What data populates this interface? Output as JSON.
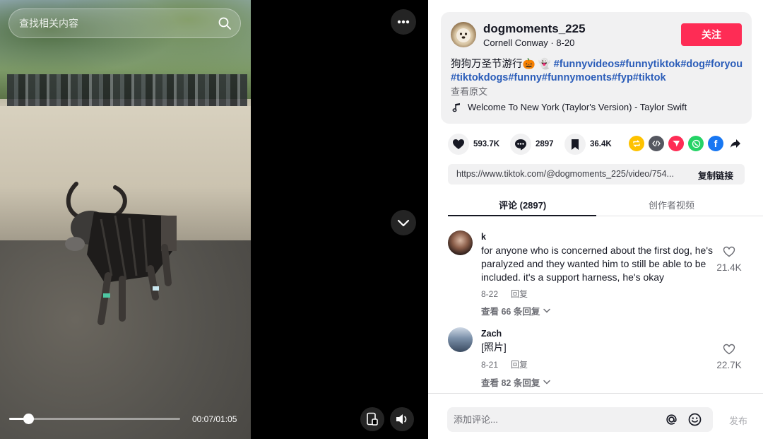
{
  "search": {
    "placeholder": "查找相关内容"
  },
  "player": {
    "time": "00:07/01:05",
    "progress_fraction": 0.11
  },
  "author": {
    "username": "dogmoments_225",
    "display_name": "Cornell Conway",
    "date": "8-20",
    "sub_line": "Cornell Conway · 8-20",
    "follow_label": "关注"
  },
  "caption": {
    "text": "狗狗万圣节游行🎃 👻 ",
    "tags_line1": "#funnyvideos#funnytiktok#dog#foryou",
    "tags_line2": "#tiktokdogs#funny#funnymoents#fyp#tiktok",
    "see_original": "查看原文"
  },
  "music": {
    "title": "Welcome To New York (Taylor's Version) - Taylor Swift"
  },
  "stats": {
    "likes": "593.7K",
    "comments": "2897",
    "saves": "36.4K"
  },
  "share_icons": [
    "repost-icon",
    "embed-icon",
    "send-icon",
    "whatsapp-icon",
    "facebook-icon",
    "share-arrow-icon"
  ],
  "link": {
    "url": "https://www.tiktok.com/@dogmoments_225/video/754...",
    "copy_label": "复制链接"
  },
  "tabs": [
    {
      "label": "评论 (2897)",
      "active": true
    },
    {
      "label": "创作者视频",
      "active": false
    }
  ],
  "comments": [
    {
      "user": "k",
      "text": "for anyone who is concerned about the first dog, he's paralyzed and they wanted him to still be able to be included. it's a support harness, he's okay",
      "date": "8-22",
      "reply_label": "回复",
      "likes": "21.4K",
      "more": "查看 66 条回复"
    },
    {
      "user": "Zach",
      "text": "[照片]",
      "date": "8-21",
      "reply_label": "回复",
      "likes": "22.7K",
      "more": "查看 82 条回复"
    }
  ],
  "composer": {
    "placeholder": "添加评论...",
    "post_label": "发布"
  },
  "colors": {
    "accent": "#fe2c55",
    "hashtag": "#2b5db9",
    "text": "#161823",
    "muted": "#6b6c73"
  }
}
